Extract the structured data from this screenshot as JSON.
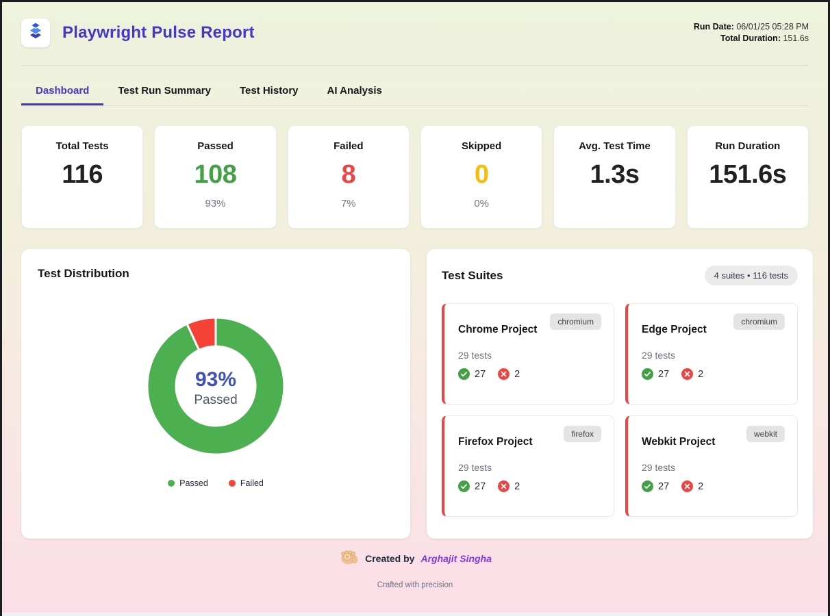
{
  "header": {
    "title": "Playwright Pulse Report",
    "logo_icon": "layers-icon",
    "run_date_label": "Run Date:",
    "run_date_value": "06/01/25 05:28 PM",
    "duration_label": "Total Duration:",
    "duration_value": "151.6s"
  },
  "tabs": [
    {
      "label": "Dashboard",
      "active": true
    },
    {
      "label": "Test Run Summary",
      "active": false
    },
    {
      "label": "Test History",
      "active": false
    },
    {
      "label": "AI Analysis",
      "active": false
    }
  ],
  "stats": [
    {
      "label": "Total Tests",
      "value": "116",
      "sub": "",
      "color": "#212121"
    },
    {
      "label": "Passed",
      "value": "108",
      "sub": "93%",
      "color": "#43a047"
    },
    {
      "label": "Failed",
      "value": "8",
      "sub": "7%",
      "color": "#ef4444"
    },
    {
      "label": "Skipped",
      "value": "0",
      "sub": "0%",
      "color": "#fbbc04"
    },
    {
      "label": "Avg. Test Time",
      "value": "1.3s",
      "sub": "",
      "color": "#212121"
    },
    {
      "label": "Run Duration",
      "value": "151.6s",
      "sub": "",
      "color": "#212121"
    }
  ],
  "distribution": {
    "title": "Test Distribution",
    "center_value": "93%",
    "center_label": "Passed",
    "legend": [
      {
        "label": "Passed",
        "color": "#4caf50"
      },
      {
        "label": "Failed",
        "color": "#f44336"
      }
    ]
  },
  "chart_data": {
    "type": "pie",
    "donut": true,
    "title": "Test Distribution",
    "categories": [
      "Passed",
      "Failed"
    ],
    "values": [
      108,
      8
    ],
    "percentages": [
      93,
      7
    ],
    "colors": [
      "#4caf50",
      "#f44336"
    ],
    "center_text": "93% Passed",
    "legend_position": "bottom"
  },
  "suites": {
    "title": "Test Suites",
    "summary_badge": "4 suites • 116 tests",
    "cards": [
      {
        "name": "Chrome Project",
        "browser": "chromium",
        "tests": "29 tests",
        "passed": "27",
        "failed": "2"
      },
      {
        "name": "Edge Project",
        "browser": "chromium",
        "tests": "29 tests",
        "passed": "27",
        "failed": "2"
      },
      {
        "name": "Firefox Project",
        "browser": "firefox",
        "tests": "29 tests",
        "passed": "27",
        "failed": "2"
      },
      {
        "name": "Webkit Project",
        "browser": "webkit",
        "tests": "29 tests",
        "passed": "27",
        "failed": "2"
      }
    ]
  },
  "footer": {
    "emoji_icon": "pointing-hand-emoji",
    "created_by_label": "Created by",
    "author": "Arghajit Singha",
    "tagline": "Crafted with precision"
  },
  "theme": {
    "accent_indigo": "#4338ca",
    "passed_green": "#4caf50",
    "failed_red": "#ef4444",
    "skipped_amber": "#fbbc04",
    "author_purple": "#7c3aed",
    "bg_top": "#edf3dc",
    "bg_bottom": "#fbdee7"
  }
}
